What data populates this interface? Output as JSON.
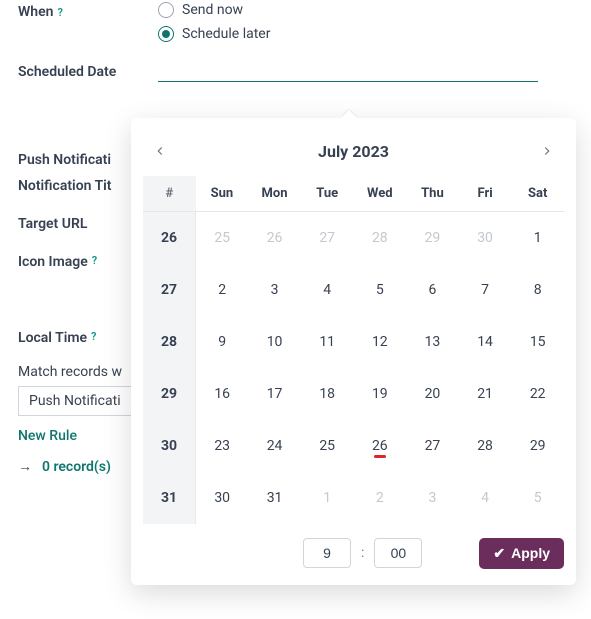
{
  "form": {
    "when_label": "When",
    "send_now": "Send now",
    "schedule_later": "Schedule later",
    "scheduled_date": "Scheduled Date",
    "push_section": "Push Notificati",
    "notif_title": "Notification Tit",
    "target_url": "Target URL",
    "icon_image": "Icon Image",
    "local_time": "Local Time",
    "match_records": "Match records w",
    "select_value": "Push Notificati",
    "new_rule": "New Rule",
    "records": "0 record(s)"
  },
  "datepicker": {
    "title": "July 2023",
    "dow": [
      "#",
      "Sun",
      "Mon",
      "Tue",
      "Wed",
      "Thu",
      "Fri",
      "Sat"
    ],
    "rows": [
      {
        "wk": "26",
        "days": [
          {
            "d": "25",
            "t": "out"
          },
          {
            "d": "26",
            "t": "out"
          },
          {
            "d": "27",
            "t": "out"
          },
          {
            "d": "28",
            "t": "out"
          },
          {
            "d": "29",
            "t": "out"
          },
          {
            "d": "30",
            "t": "out"
          },
          {
            "d": "1",
            "t": "in"
          }
        ]
      },
      {
        "wk": "27",
        "days": [
          {
            "d": "2",
            "t": "in"
          },
          {
            "d": "3",
            "t": "in"
          },
          {
            "d": "4",
            "t": "in"
          },
          {
            "d": "5",
            "t": "in"
          },
          {
            "d": "6",
            "t": "in"
          },
          {
            "d": "7",
            "t": "in"
          },
          {
            "d": "8",
            "t": "in"
          }
        ]
      },
      {
        "wk": "28",
        "days": [
          {
            "d": "9",
            "t": "in"
          },
          {
            "d": "10",
            "t": "in"
          },
          {
            "d": "11",
            "t": "in"
          },
          {
            "d": "12",
            "t": "in"
          },
          {
            "d": "13",
            "t": "in"
          },
          {
            "d": "14",
            "t": "in"
          },
          {
            "d": "15",
            "t": "in"
          }
        ]
      },
      {
        "wk": "29",
        "days": [
          {
            "d": "16",
            "t": "in"
          },
          {
            "d": "17",
            "t": "in"
          },
          {
            "d": "18",
            "t": "in"
          },
          {
            "d": "19",
            "t": "in"
          },
          {
            "d": "20",
            "t": "in"
          },
          {
            "d": "21",
            "t": "in"
          },
          {
            "d": "22",
            "t": "in"
          }
        ]
      },
      {
        "wk": "30",
        "days": [
          {
            "d": "23",
            "t": "in"
          },
          {
            "d": "24",
            "t": "in"
          },
          {
            "d": "25",
            "t": "in"
          },
          {
            "d": "26",
            "t": "in",
            "today": true
          },
          {
            "d": "27",
            "t": "in"
          },
          {
            "d": "28",
            "t": "in"
          },
          {
            "d": "29",
            "t": "in"
          }
        ]
      },
      {
        "wk": "31",
        "days": [
          {
            "d": "30",
            "t": "in"
          },
          {
            "d": "31",
            "t": "in"
          },
          {
            "d": "1",
            "t": "out"
          },
          {
            "d": "2",
            "t": "out"
          },
          {
            "d": "3",
            "t": "out"
          },
          {
            "d": "4",
            "t": "out"
          },
          {
            "d": "5",
            "t": "out"
          }
        ]
      }
    ],
    "hour": "9",
    "minute": "00",
    "apply": "Apply"
  },
  "glyphs": {
    "help": "?",
    "arrow": "→",
    "check": "✔"
  }
}
